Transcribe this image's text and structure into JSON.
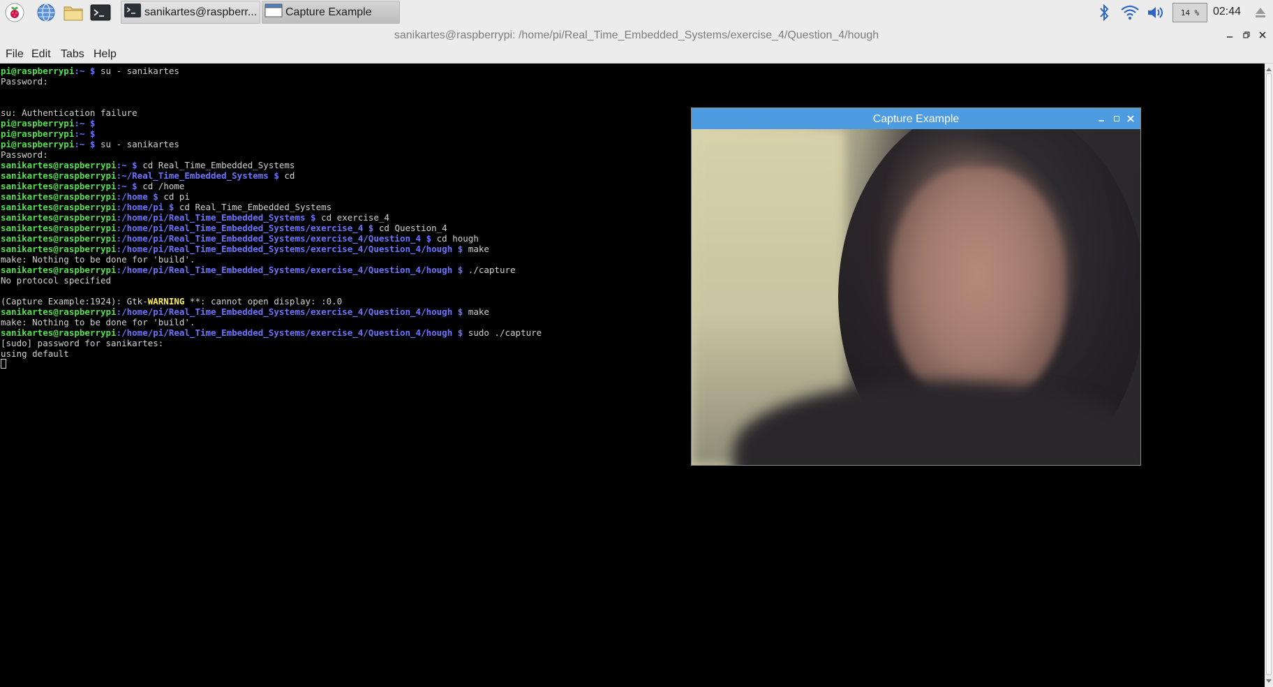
{
  "taskbar": {
    "launchers": [
      {
        "name": "raspberry-menu-icon"
      },
      {
        "name": "web-browser-icon"
      },
      {
        "name": "file-manager-icon"
      },
      {
        "name": "terminal-icon"
      }
    ],
    "tasks": [
      {
        "label": "sanikartes@raspberr...",
        "icon": "terminal-icon",
        "active": false
      },
      {
        "label": "Capture Example",
        "icon": "window-icon",
        "active": true
      }
    ],
    "tray": {
      "bluetooth_icon": "bluetooth-icon",
      "wifi_icon": "wifi-icon",
      "volume_icon": "volume-icon",
      "cpu_usage": "14 %",
      "clock": "02:44",
      "eject_icon": "eject-icon"
    }
  },
  "terminal": {
    "title": "sanikartes@raspberrypi: /home/pi/Real_Time_Embedded_Systems/exercise_4/Question_4/hough",
    "menu": [
      "File",
      "Edit",
      "Tabs",
      "Help"
    ],
    "lines": [
      {
        "user": "pi@raspberrypi",
        "path": ":~ $",
        "text": " su - sanikartes"
      },
      {
        "text": "Password:"
      },
      {
        "text": ""
      },
      {
        "text": ""
      },
      {
        "text": "su: Authentication failure"
      },
      {
        "user": "pi@raspberrypi",
        "path": ":~ $",
        "text": ""
      },
      {
        "user": "pi@raspberrypi",
        "path": ":~ $",
        "text": ""
      },
      {
        "user": "pi@raspberrypi",
        "path": ":~ $",
        "text": " su - sanikartes"
      },
      {
        "text": "Password:"
      },
      {
        "user": "sanikartes@raspberrypi",
        "path": ":~ $",
        "text": " cd Real_Time_Embedded_Systems"
      },
      {
        "user": "sanikartes@raspberrypi",
        "path": ":~/Real_Time_Embedded_Systems $",
        "text": " cd"
      },
      {
        "user": "sanikartes@raspberrypi",
        "path": ":~ $",
        "text": " cd /home"
      },
      {
        "user": "sanikartes@raspberrypi",
        "path": ":/home $",
        "text": " cd pi"
      },
      {
        "user": "sanikartes@raspberrypi",
        "path": ":/home/pi $",
        "text": " cd Real_Time_Embedded_Systems"
      },
      {
        "user": "sanikartes@raspberrypi",
        "path": ":/home/pi/Real_Time_Embedded_Systems $",
        "text": " cd exercise_4"
      },
      {
        "user": "sanikartes@raspberrypi",
        "path": ":/home/pi/Real_Time_Embedded_Systems/exercise_4 $",
        "text": " cd Question_4"
      },
      {
        "user": "sanikartes@raspberrypi",
        "path": ":/home/pi/Real_Time_Embedded_Systems/exercise_4/Question_4 $",
        "text": " cd hough"
      },
      {
        "user": "sanikartes@raspberrypi",
        "path": ":/home/pi/Real_Time_Embedded_Systems/exercise_4/Question_4/hough $",
        "text": " make"
      },
      {
        "text": "make: Nothing to be done for 'build'."
      },
      {
        "user": "sanikartes@raspberrypi",
        "path": ":/home/pi/Real_Time_Embedded_Systems/exercise_4/Question_4/hough $",
        "text": " ./capture"
      },
      {
        "text": "No protocol specified"
      },
      {
        "text": ""
      },
      {
        "text": "(Capture Example:1924): Gtk-",
        "warn": "WARNING",
        "after": " **: cannot open display: :0.0"
      },
      {
        "user": "sanikartes@raspberrypi",
        "path": ":/home/pi/Real_Time_Embedded_Systems/exercise_4/Question_4/hough $",
        "text": " make"
      },
      {
        "text": "make: Nothing to be done for 'build'."
      },
      {
        "user": "sanikartes@raspberrypi",
        "path": ":/home/pi/Real_Time_Embedded_Systems/exercise_4/Question_4/hough $",
        "text": " sudo ./capture"
      },
      {
        "text": "[sudo] password for sanikartes:"
      },
      {
        "text": "using default"
      }
    ]
  },
  "capture_window": {
    "title": "Capture Example",
    "image_description": "webcam frame"
  },
  "colors": {
    "prompt_user": "#55e04f",
    "prompt_path": "#6c74ff",
    "warning": "#ffee55",
    "capture_titlebar": "#4d9be0"
  }
}
